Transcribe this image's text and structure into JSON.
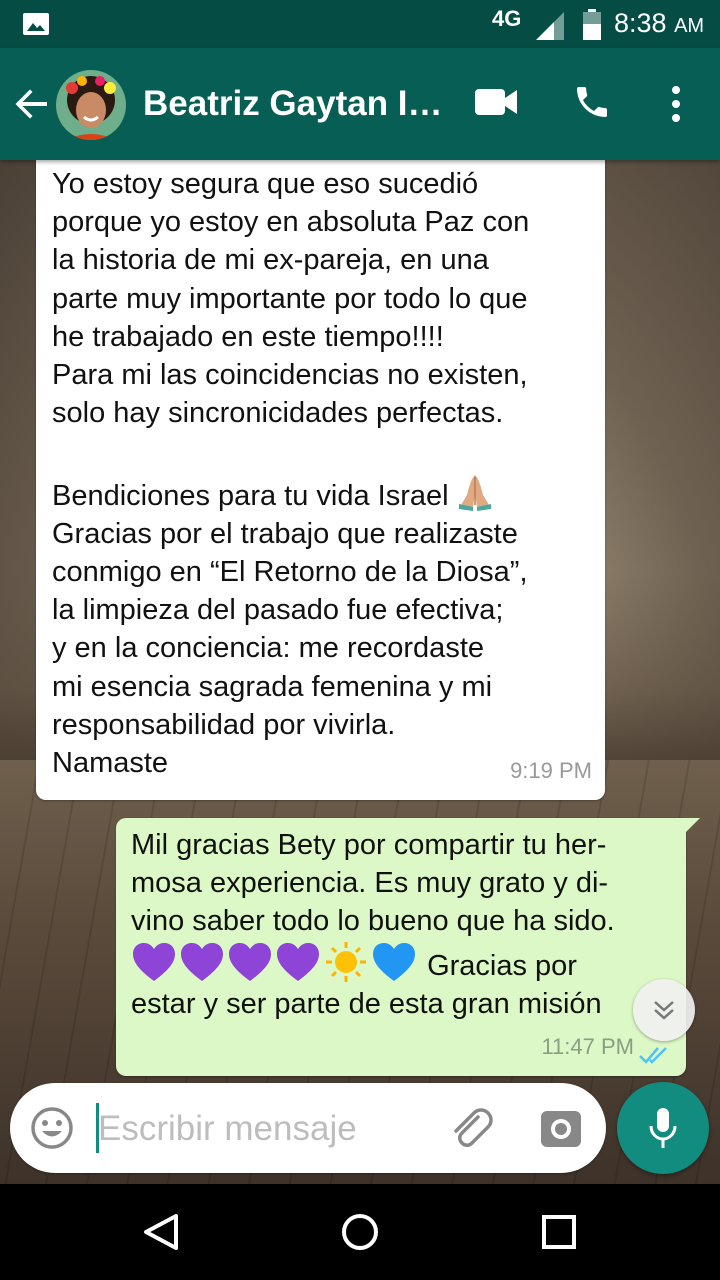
{
  "status_bar": {
    "network": "4G",
    "time": "8:38",
    "ampm": "AM"
  },
  "header": {
    "contact_name": "Beatriz Gaytan In..."
  },
  "messages": [
    {
      "direction": "incoming",
      "part1": "Yo estoy segura que eso sucedió\nporque yo estoy en absoluta Paz con\nla historia de mi ex-pareja, en una\nparte muy importante por todo lo que\nhe trabajado en este tiempo!!!!\nPara mi las coincidencias no existen,\nsolo hay sincronicidades perfectas.\n\nBendiciones para tu vida Israel",
      "part2": "Gracias por  el trabajo que realizaste\nconmigo en “El Retorno de la Diosa”,\nla limpieza del pasado fue efectiva;\ny en la conciencia: me recordaste\nmi esencia sagrada femenina y mi\nresponsabilidad por vivirla.\nNamaste",
      "time": "9:19 PM"
    },
    {
      "direction": "outgoing",
      "line1": "Mil gracias Bety por compartir tu her-",
      "line2": "mosa experiencia. Es muy grato y di-",
      "line3": "vino saber todo lo bueno que ha sido.",
      "line4_text": "Gracias por",
      "line5": "estar y ser parte de esta gran misión",
      "time": "11:47 PM",
      "status": "read"
    }
  ],
  "composer": {
    "placeholder": "Escribir mensaje"
  },
  "colors": {
    "header": "#075e54",
    "status_bar": "#054d44",
    "accent": "#128c7e",
    "outgoing_bubble": "#dcf8c6",
    "incoming_bubble": "#ffffff",
    "read_ticks": "#4fc3f7"
  },
  "icons": [
    "gallery-notification-icon",
    "signal-icon",
    "battery-icon",
    "back-arrow-icon",
    "video-call-icon",
    "phone-call-icon",
    "more-options-icon",
    "praying-hands-emoji",
    "purple-heart-emoji",
    "sun-emoji",
    "blue-heart-emoji",
    "double-check-icon",
    "scroll-down-icon",
    "emoji-icon",
    "attach-icon",
    "camera-icon",
    "mic-icon",
    "nav-back-icon",
    "nav-home-icon",
    "nav-recents-icon"
  ]
}
